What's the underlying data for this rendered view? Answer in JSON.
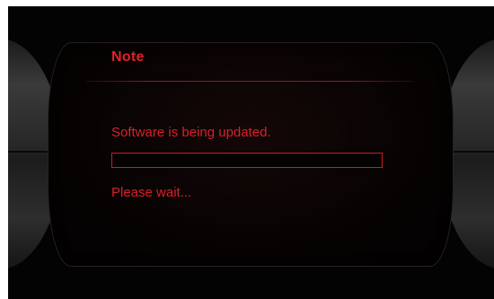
{
  "dialog": {
    "title": "Note",
    "message": "Software is being updated.",
    "progress": 0,
    "status": "Please wait..."
  },
  "colors": {
    "text": "#e2202a",
    "background": "#030303"
  }
}
